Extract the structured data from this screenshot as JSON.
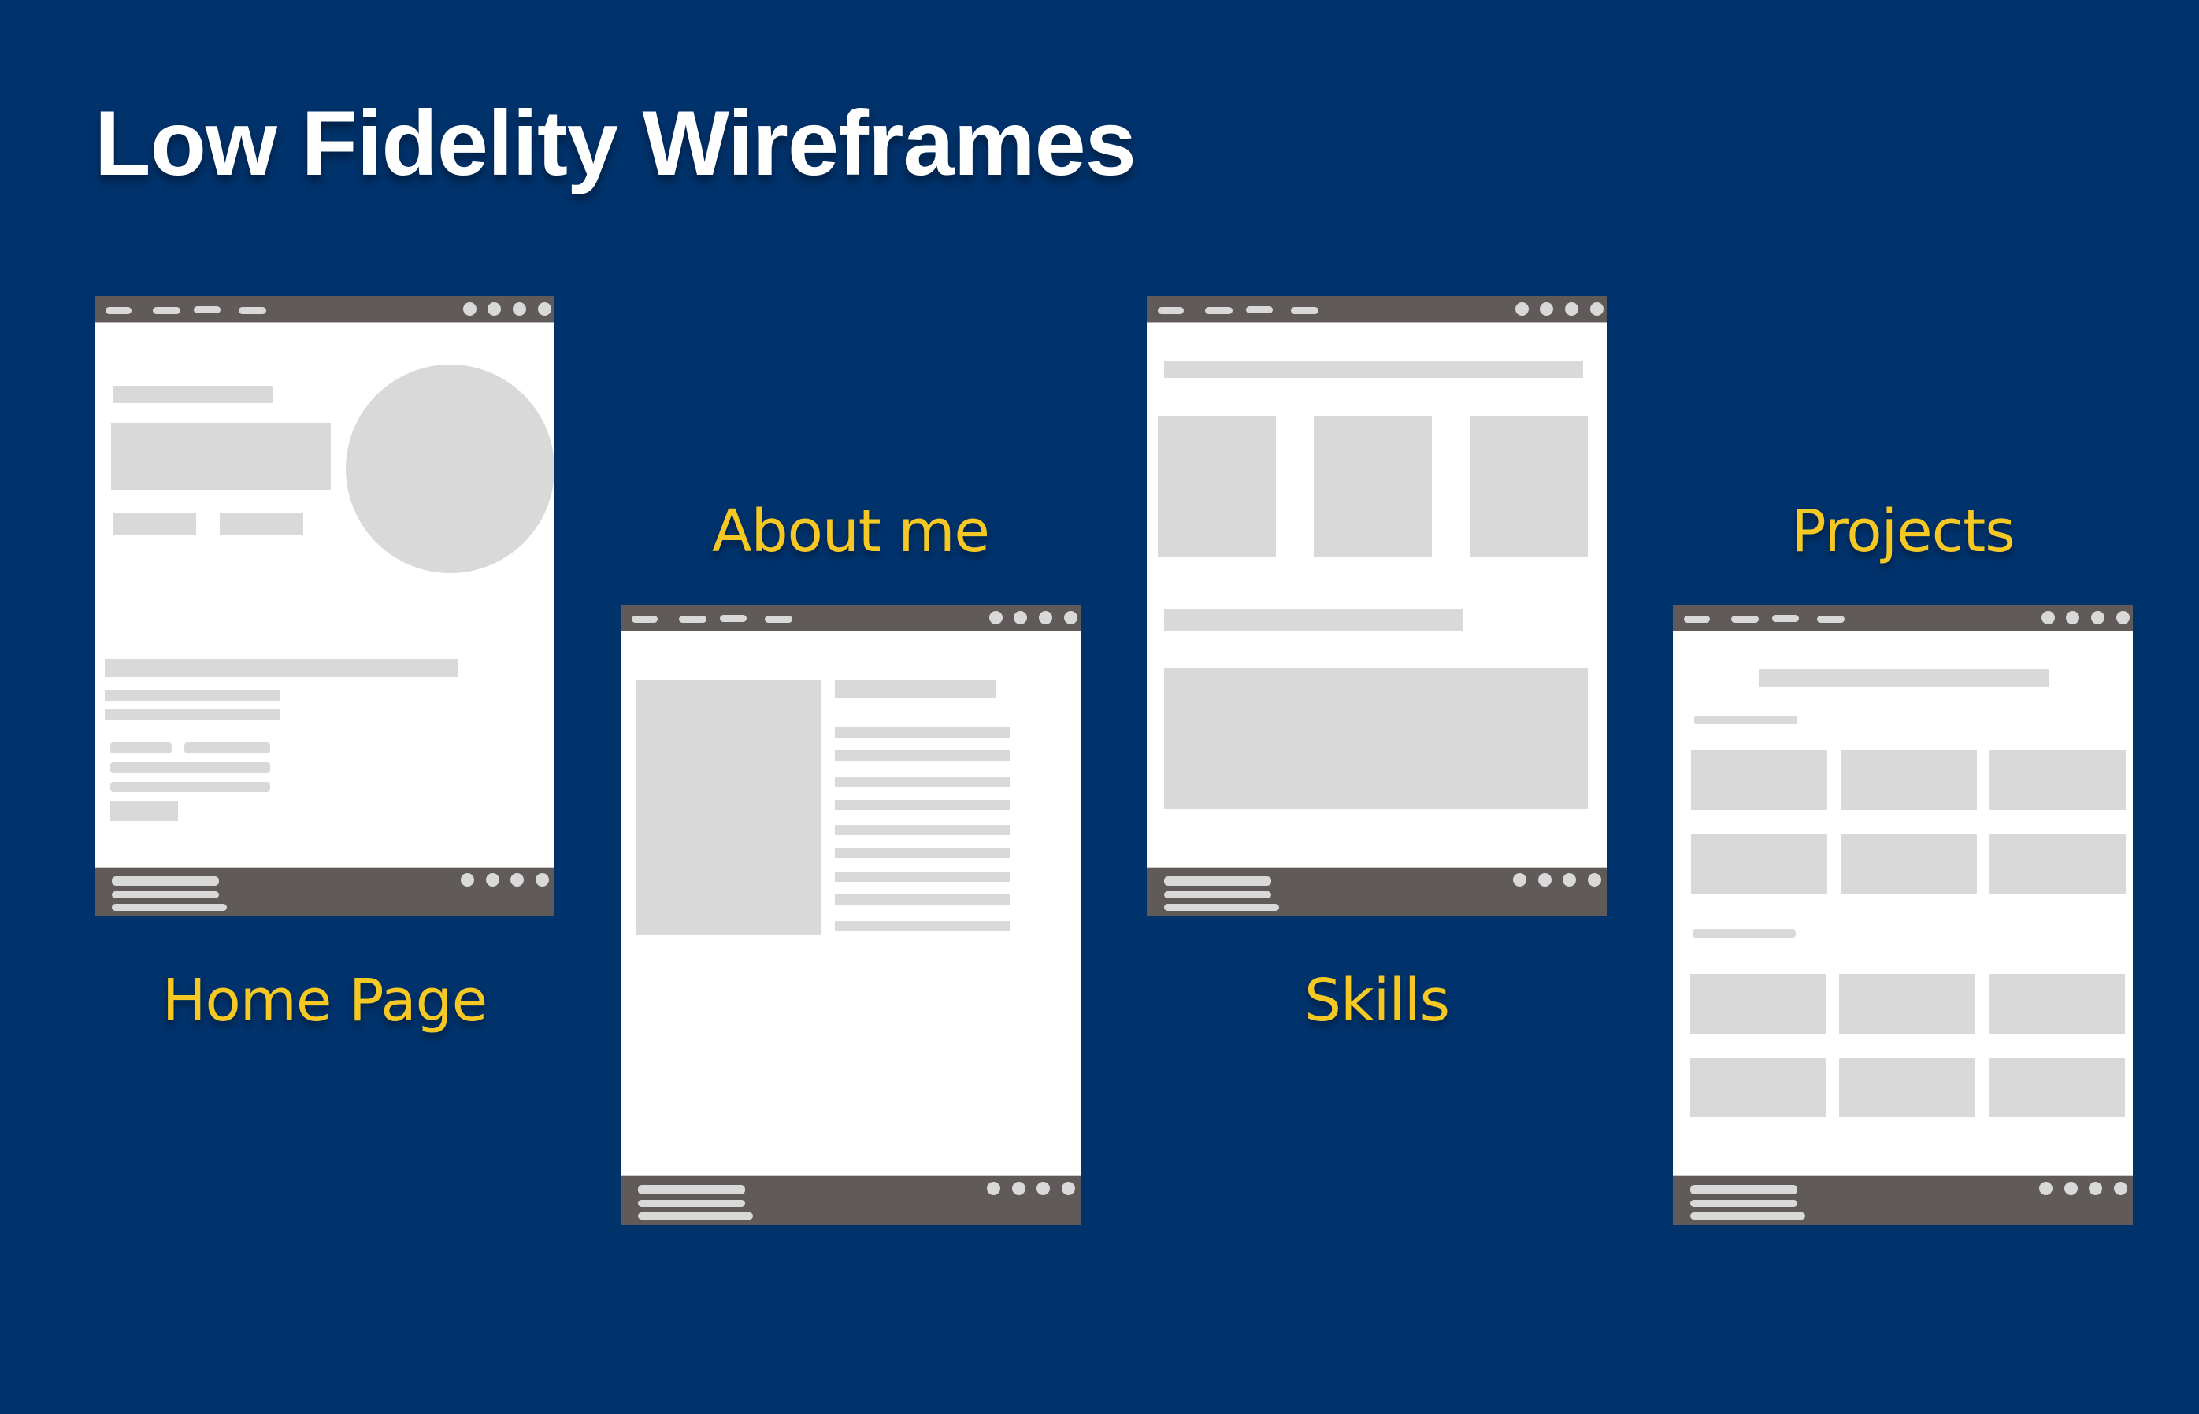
{
  "page": {
    "title": "Low Fidelity Wireframes",
    "background_color": "#00326B",
    "label_color": "#F6C824",
    "wireframe_bar_color": "#605A59",
    "placeholder_color": "#D9D9D9"
  },
  "wireframes": [
    {
      "id": "home",
      "label": "Home Page",
      "nav_items": 4,
      "social_icons": 4
    },
    {
      "id": "about",
      "label": "About me",
      "nav_items": 4,
      "social_icons": 4
    },
    {
      "id": "skills",
      "label": "Skills",
      "nav_items": 4,
      "social_icons": 4
    },
    {
      "id": "projects",
      "label": "Projects",
      "nav_items": 4,
      "social_icons": 4
    }
  ]
}
